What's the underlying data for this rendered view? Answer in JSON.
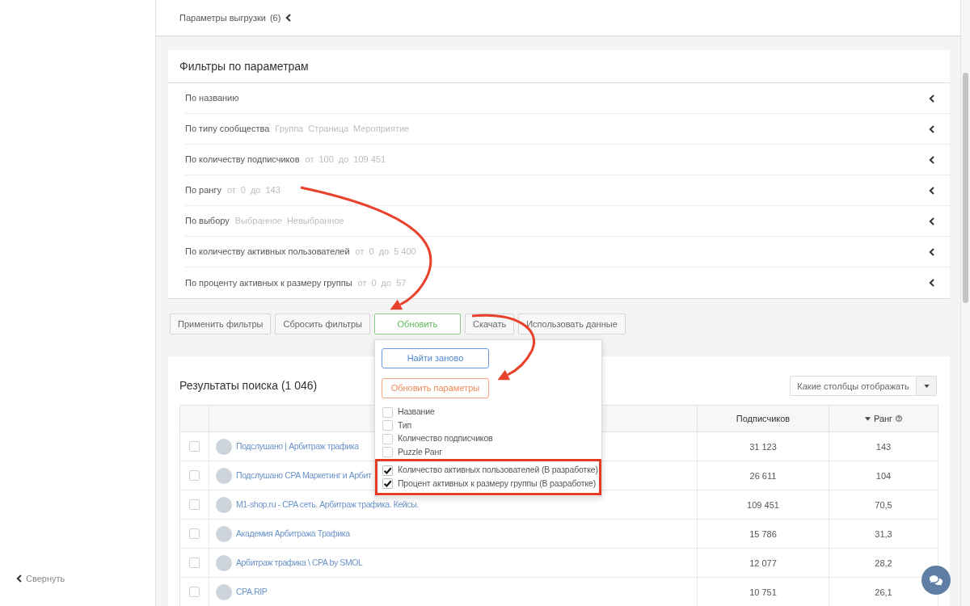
{
  "sidebar": {
    "collapse_label": "Свернуть"
  },
  "export_panel": {
    "label": "Параметры выгрузки",
    "count": "(6)",
    "expanded": false
  },
  "filters": {
    "title": "Фильтры по параметрам",
    "rows": [
      {
        "label": "По названию",
        "expanded": false
      },
      {
        "label": "По типу сообщества",
        "values": [
          "Группа",
          "Страница",
          "Мероприятие"
        ],
        "expanded": false
      },
      {
        "label": "По количеству подписчиков",
        "values": [
          "от",
          "100",
          "до",
          "109 451"
        ],
        "expanded": false
      },
      {
        "label": "По рангу",
        "values": [
          "от",
          "0",
          "до",
          "143"
        ],
        "expanded": false
      },
      {
        "label": "По выбору",
        "values": [
          "Выбранное",
          "Невыбранное"
        ],
        "expanded": false
      },
      {
        "label": "По количеству активных пользователей",
        "values": [
          "от",
          "0",
          "до",
          "5 400"
        ],
        "expanded": false
      },
      {
        "label": "По проценту активных к размеру группы",
        "values": [
          "от",
          "0",
          "до",
          "57"
        ],
        "expanded": false
      }
    ]
  },
  "actions": [
    {
      "label": "Применить фильтры",
      "expanded": false
    },
    {
      "label": "Сбросить фильтры",
      "expanded": false
    },
    {
      "label": "Обновить",
      "expanded": true
    },
    {
      "label": "Скачать",
      "expanded": false
    },
    {
      "label": "Использовать данные",
      "expanded": false
    }
  ],
  "update_menu": {
    "buttons": [
      {
        "label": "Найти заново",
        "kind": "primary"
      },
      {
        "label": "Обновить параметры",
        "kind": "warning"
      }
    ],
    "columns": [
      {
        "label": "Название",
        "checked": false,
        "highlighted": false
      },
      {
        "label": "Тип",
        "checked": false,
        "highlighted": false
      },
      {
        "label": "Количество подписчиков",
        "checked": false,
        "highlighted": false
      },
      {
        "label": "Puzzle Ранг",
        "checked": false,
        "highlighted": false
      },
      {
        "label": "Количество активных пользователей (В разработке)",
        "checked": true,
        "highlighted": true
      },
      {
        "label": "Процент активных к размеру группы (В разработке)",
        "checked": true,
        "highlighted": true
      }
    ]
  },
  "results": {
    "title": "Результаты поиска (1 046)",
    "columns_button": {
      "label": "Какие столбцы отображать"
    },
    "table": {
      "columns": [
        {
          "label": "Подписчиков",
          "sorted": false,
          "info": false
        },
        {
          "label": "Ранг",
          "sorted": true,
          "info": true
        }
      ],
      "rows": [
        {
          "checked": false,
          "name": "Подслушано | Арбитраж трафика",
          "subscribers": "31 123",
          "rank": "143"
        },
        {
          "checked": false,
          "name": "Подслушано CPA Маркетинг и Арбит",
          "subscribers": "26 611",
          "rank": "104"
        },
        {
          "checked": false,
          "name": "M1-shop.ru - CPA сеть. Арбитраж трафика. Кейсы.",
          "subscribers": "109 451",
          "rank": "70,5"
        },
        {
          "checked": false,
          "name": "Академия Арбитража Трафика",
          "subscribers": "15 786",
          "rank": "31,3"
        },
        {
          "checked": false,
          "name": "Арбитраж трафика \\ CPA by SMOL",
          "subscribers": "12 077",
          "rank": "28,2"
        },
        {
          "checked": false,
          "name": "CPA.RIP",
          "subscribers": "10 751",
          "rank": "26,1"
        }
      ]
    }
  }
}
